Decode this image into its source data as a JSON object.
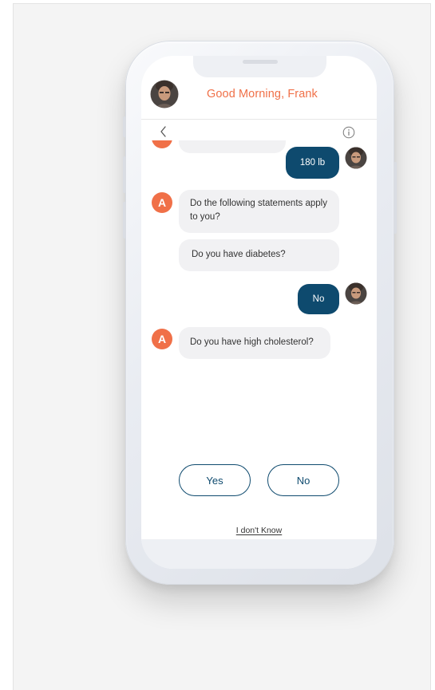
{
  "header": {
    "greeting": "Good Morning, Frank"
  },
  "chat": {
    "messages": [
      {
        "sender": "bot",
        "text": ""
      },
      {
        "sender": "user",
        "text": "180 lb"
      },
      {
        "sender": "bot",
        "avatar_letter": "A",
        "text": "Do the following statements apply to you?"
      },
      {
        "sender": "bot",
        "text": "Do you have diabetes?"
      },
      {
        "sender": "user",
        "text": "No"
      },
      {
        "sender": "bot",
        "avatar_letter": "A",
        "text": "Do you have high cholesterol?"
      }
    ]
  },
  "answers": {
    "yes_label": "Yes",
    "no_label": "No",
    "dont_know_label": "I don't Know"
  },
  "colors": {
    "accent": "#f07048",
    "primary": "#0e4a6e",
    "bot_bubble": "#f1f1f3"
  },
  "icons": [
    "back-chevron-icon",
    "info-icon"
  ]
}
